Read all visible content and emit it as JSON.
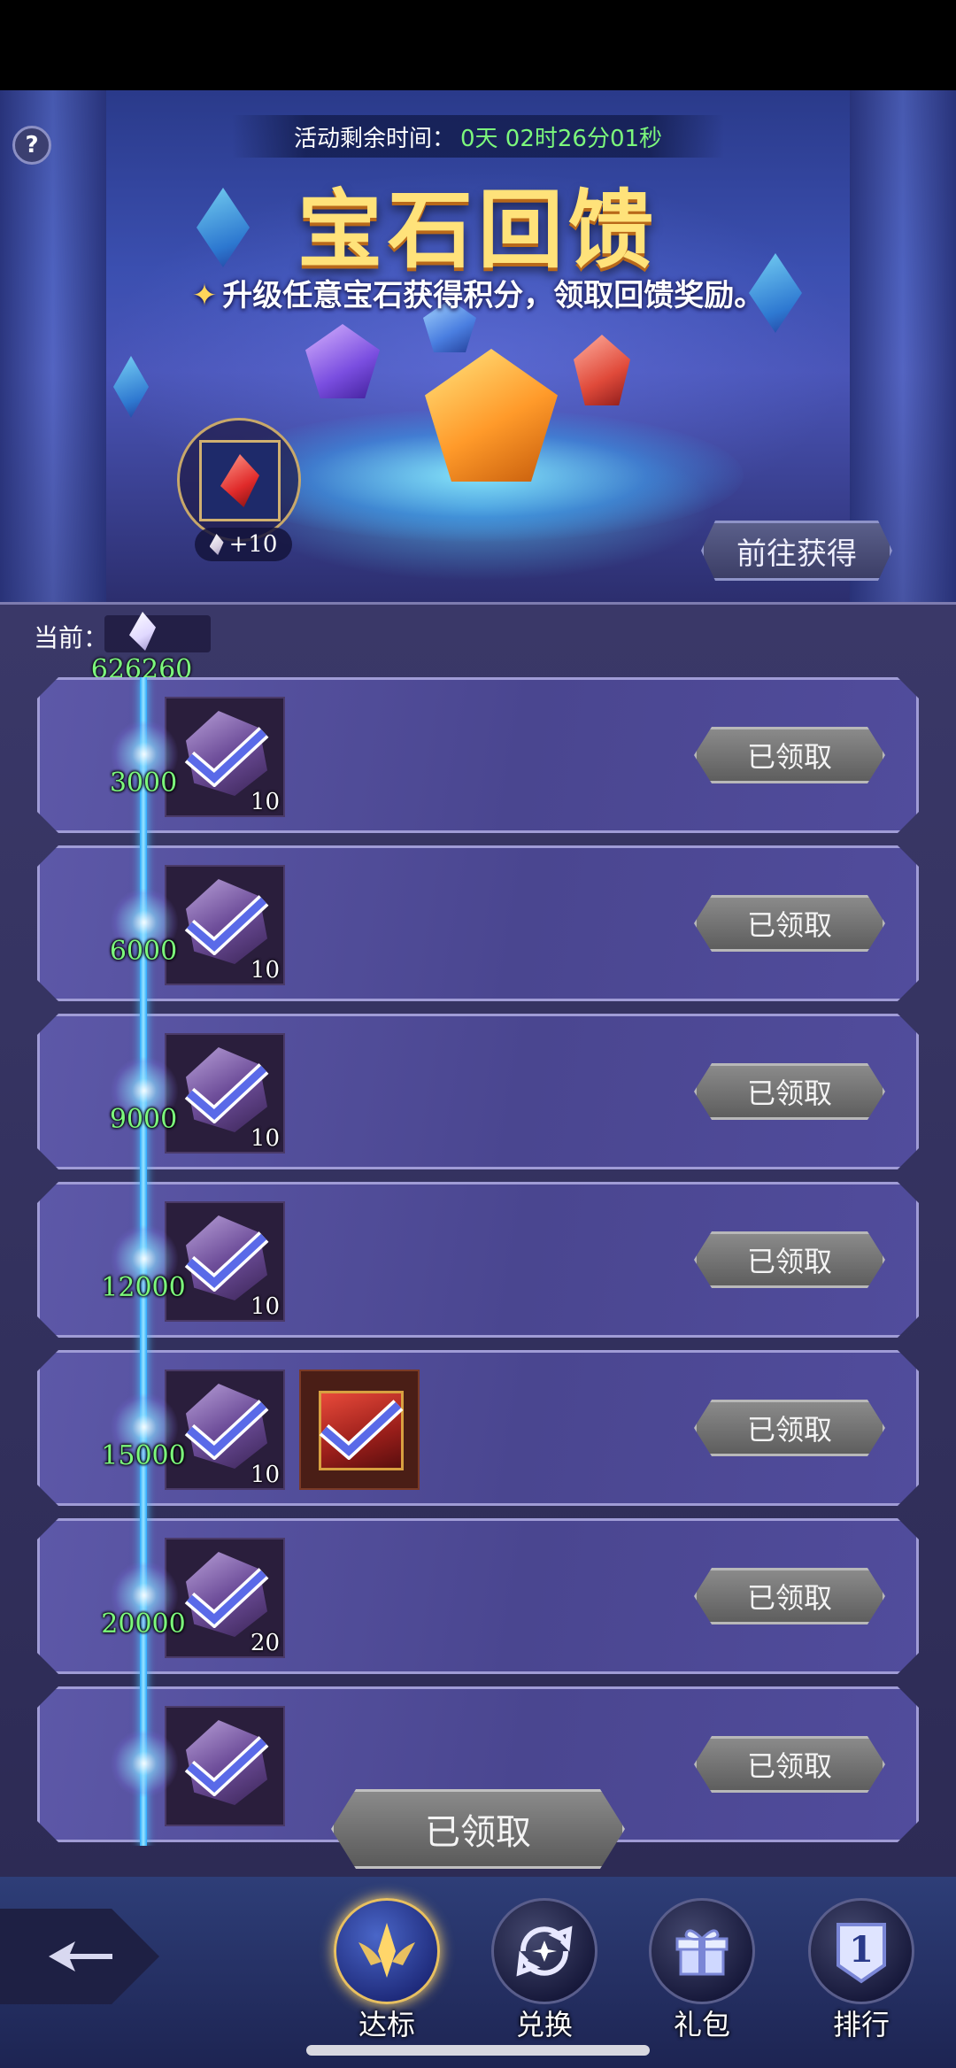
{
  "banner": {
    "timer_label": "活动剩余时间：",
    "timer_value": "0天  02时26分01秒",
    "title": "宝石回馈",
    "subtitle": "升级任意宝石获得积分，领取回馈奖励。",
    "points_badge": "+10",
    "go_button": "前往获得"
  },
  "current": {
    "label": "当前：",
    "value": "626260"
  },
  "rows": [
    {
      "milestone": "3000",
      "rewards": [
        {
          "type": "stone",
          "qty": "10"
        }
      ],
      "button": "已领取"
    },
    {
      "milestone": "6000",
      "rewards": [
        {
          "type": "stone",
          "qty": "10"
        }
      ],
      "button": "已领取"
    },
    {
      "milestone": "9000",
      "rewards": [
        {
          "type": "stone",
          "qty": "10"
        }
      ],
      "button": "已领取"
    },
    {
      "milestone": "12000",
      "rewards": [
        {
          "type": "stone",
          "qty": "10"
        }
      ],
      "button": "已领取"
    },
    {
      "milestone": "15000",
      "rewards": [
        {
          "type": "stone",
          "qty": "10"
        },
        {
          "type": "gift",
          "qty": ""
        }
      ],
      "button": "已领取"
    },
    {
      "milestone": "20000",
      "rewards": [
        {
          "type": "stone",
          "qty": "20"
        }
      ],
      "button": "已领取"
    },
    {
      "milestone": "",
      "rewards": [
        {
          "type": "stone",
          "qty": ""
        }
      ],
      "button": "已领取"
    }
  ],
  "bottom_button": "已领取",
  "nav": [
    {
      "label": "达标",
      "icon": "wings-emblem-icon",
      "active": true
    },
    {
      "label": "兑换",
      "icon": "exchange-icon",
      "active": false
    },
    {
      "label": "礼包",
      "icon": "gift-icon",
      "active": false
    },
    {
      "label": "排行",
      "icon": "ranking-badge-icon",
      "active": false
    }
  ],
  "colors": {
    "accent_green": "#7cf87c",
    "title_gold": "#ffe27a",
    "panel_purple": "#4a4690",
    "claimed_gray": "#6e6e6e"
  }
}
